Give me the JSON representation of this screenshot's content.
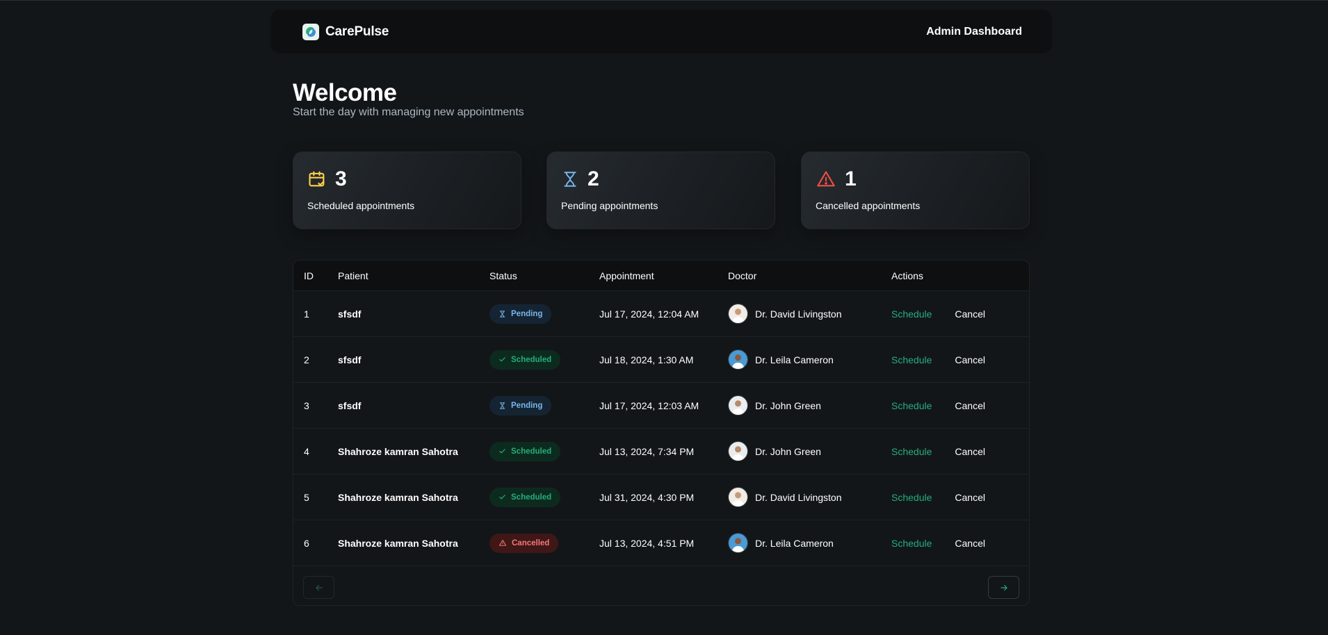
{
  "header": {
    "brand": "CarePulse",
    "admin_link": "Admin Dashboard"
  },
  "welcome": {
    "title": "Welcome",
    "subtitle": "Start the day with managing new appointments"
  },
  "stats": {
    "scheduled": {
      "count": "3",
      "label": "Scheduled appointments",
      "color": "#ffd147"
    },
    "pending": {
      "count": "2",
      "label": "Pending appointments",
      "color": "#79b5ec"
    },
    "cancelled": {
      "count": "1",
      "label": "Cancelled appointments",
      "color": "#f24e43"
    }
  },
  "table": {
    "columns": [
      "ID",
      "Patient",
      "Status",
      "Appointment",
      "Doctor",
      "Actions"
    ],
    "rows": [
      {
        "id": "1",
        "patient": "sfsdf",
        "status": "Pending",
        "appointment": "Jul 17, 2024, 12:04 AM",
        "doctor": "Dr. David Livingston"
      },
      {
        "id": "2",
        "patient": "sfsdf",
        "status": "Scheduled",
        "appointment": "Jul 18, 2024, 1:30 AM",
        "doctor": "Dr. Leila Cameron"
      },
      {
        "id": "3",
        "patient": "sfsdf",
        "status": "Pending",
        "appointment": "Jul 17, 2024, 12:03 AM",
        "doctor": "Dr. John Green"
      },
      {
        "id": "4",
        "patient": "Shahroze kamran Sahotra",
        "status": "Scheduled",
        "appointment": "Jul 13, 2024, 7:34 PM",
        "doctor": "Dr. John Green"
      },
      {
        "id": "5",
        "patient": "Shahroze kamran Sahotra",
        "status": "Scheduled",
        "appointment": "Jul 31, 2024, 4:30 PM",
        "doctor": "Dr. David Livingston"
      },
      {
        "id": "6",
        "patient": "Shahroze kamran Sahotra",
        "status": "Cancelled",
        "appointment": "Jul 13, 2024, 4:51 PM",
        "doctor": "Dr. Leila Cameron"
      }
    ],
    "actions": {
      "schedule": "Schedule",
      "cancel": "Cancel"
    }
  },
  "pagination": {
    "prev_icon": "arrow-left-icon",
    "next_icon": "arrow-right-icon"
  },
  "colors": {
    "background": "#131619",
    "header_bg": "#0d0f10",
    "green": "#24ae7c",
    "blue": "#79b5ec",
    "red": "#f37877",
    "yellow": "#ffd147"
  }
}
